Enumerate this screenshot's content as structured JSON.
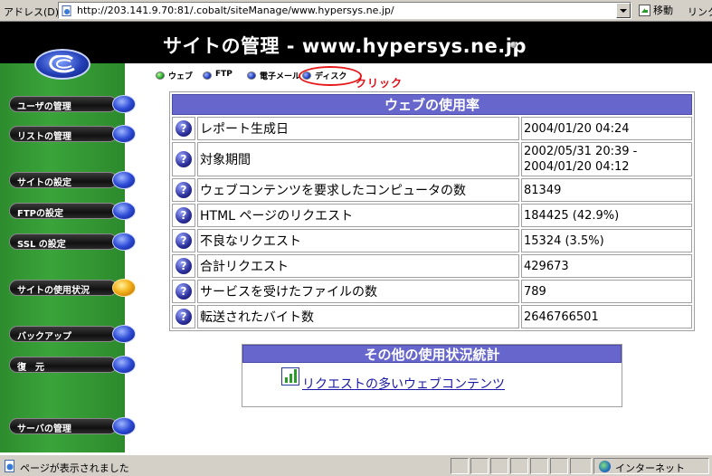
{
  "browser": {
    "address_label": "アドレス(D)",
    "url": "http://203.141.9.70:81/.cobalt/siteManage/www.hypersys.ne.jp/",
    "go_label": "移動",
    "links_label": "リンク"
  },
  "header": {
    "title": "サイトの管理 - www.hypersys.ne.jp"
  },
  "sidebar": {
    "items": [
      {
        "label": "ユーザの管理",
        "active": false
      },
      {
        "label": "リストの管理",
        "active": false
      },
      {
        "label": "サイトの設定",
        "active": false
      },
      {
        "label": "FTPの設定",
        "active": false
      },
      {
        "label": "SSL の設定",
        "active": false
      },
      {
        "label": "サイトの使用状況",
        "active": true
      },
      {
        "label": "バックアップ",
        "active": false
      },
      {
        "label": "復　元",
        "active": false
      },
      {
        "label": "サーバの管理",
        "active": false
      }
    ]
  },
  "subtabs": [
    {
      "label": "ウェブ",
      "selected": true
    },
    {
      "label": "FTP",
      "selected": false
    },
    {
      "label": "電子メール",
      "selected": false
    },
    {
      "label": "ディスク",
      "selected": false
    }
  ],
  "annotation": {
    "text": "クリック"
  },
  "usage": {
    "title": "ウェブの使用率",
    "rows": [
      {
        "label": "レポート生成日",
        "value": "2004/01/20 04:24"
      },
      {
        "label": "対象期間",
        "value": "2002/05/31 20:39 -",
        "value2": "2004/01/20 04:12"
      },
      {
        "label": "ウェブコンテンツを要求したコンピュータの数",
        "value": "81349"
      },
      {
        "label": "HTML ページのリクエスト",
        "value": "184425 (42.9%)"
      },
      {
        "label": "不良なリクエスト",
        "value": "15324 (3.5%)"
      },
      {
        "label": "合計リクエスト",
        "value": "429673"
      },
      {
        "label": "サービスを受けたファイルの数",
        "value": "789"
      },
      {
        "label": "転送されたバイト数",
        "value": "2646766501"
      }
    ]
  },
  "other_stats": {
    "title": "その他の使用状況統計",
    "link": "リクエストの多いウェブコンテンツ"
  },
  "status_bar": {
    "text": "ページが表示されました",
    "zone": "インターネット"
  },
  "colors": {
    "table_header": "#6666cc",
    "sidebar_green": "#3aa43a",
    "annotation_red": "#e8191a"
  }
}
